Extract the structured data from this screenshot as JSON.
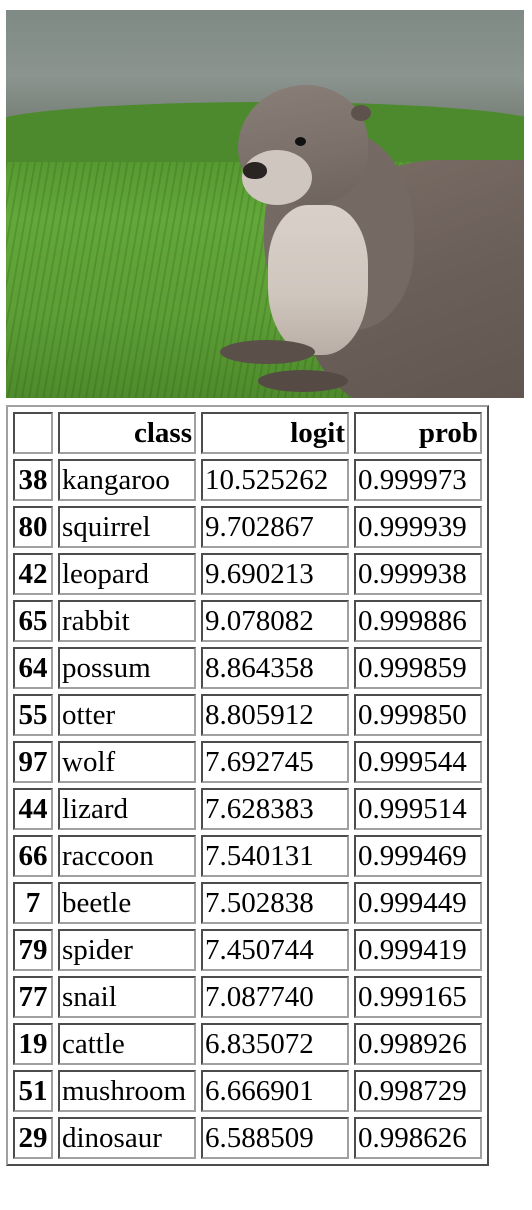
{
  "image": {
    "subject": "otter"
  },
  "table": {
    "headers": {
      "index": "",
      "class": "class",
      "logit": "logit",
      "prob": "prob"
    },
    "rows": [
      {
        "index": "38",
        "class": "kangaroo",
        "logit": "10.525262",
        "prob": "0.999973"
      },
      {
        "index": "80",
        "class": "squirrel",
        "logit": "9.702867",
        "prob": "0.999939"
      },
      {
        "index": "42",
        "class": "leopard",
        "logit": "9.690213",
        "prob": "0.999938"
      },
      {
        "index": "65",
        "class": "rabbit",
        "logit": "9.078082",
        "prob": "0.999886"
      },
      {
        "index": "64",
        "class": "possum",
        "logit": "8.864358",
        "prob": "0.999859"
      },
      {
        "index": "55",
        "class": "otter",
        "logit": "8.805912",
        "prob": "0.999850"
      },
      {
        "index": "97",
        "class": "wolf",
        "logit": "7.692745",
        "prob": "0.999544"
      },
      {
        "index": "44",
        "class": "lizard",
        "logit": "7.628383",
        "prob": "0.999514"
      },
      {
        "index": "66",
        "class": "raccoon",
        "logit": "7.540131",
        "prob": "0.999469"
      },
      {
        "index": "7",
        "class": "beetle",
        "logit": "7.502838",
        "prob": "0.999449"
      },
      {
        "index": "79",
        "class": "spider",
        "logit": "7.450744",
        "prob": "0.999419"
      },
      {
        "index": "77",
        "class": "snail",
        "logit": "7.087740",
        "prob": "0.999165"
      },
      {
        "index": "19",
        "class": "cattle",
        "logit": "6.835072",
        "prob": "0.998926"
      },
      {
        "index": "51",
        "class": "mushroom",
        "logit": "6.666901",
        "prob": "0.998729"
      },
      {
        "index": "29",
        "class": "dinosaur",
        "logit": "6.588509",
        "prob": "0.998626"
      }
    ]
  }
}
